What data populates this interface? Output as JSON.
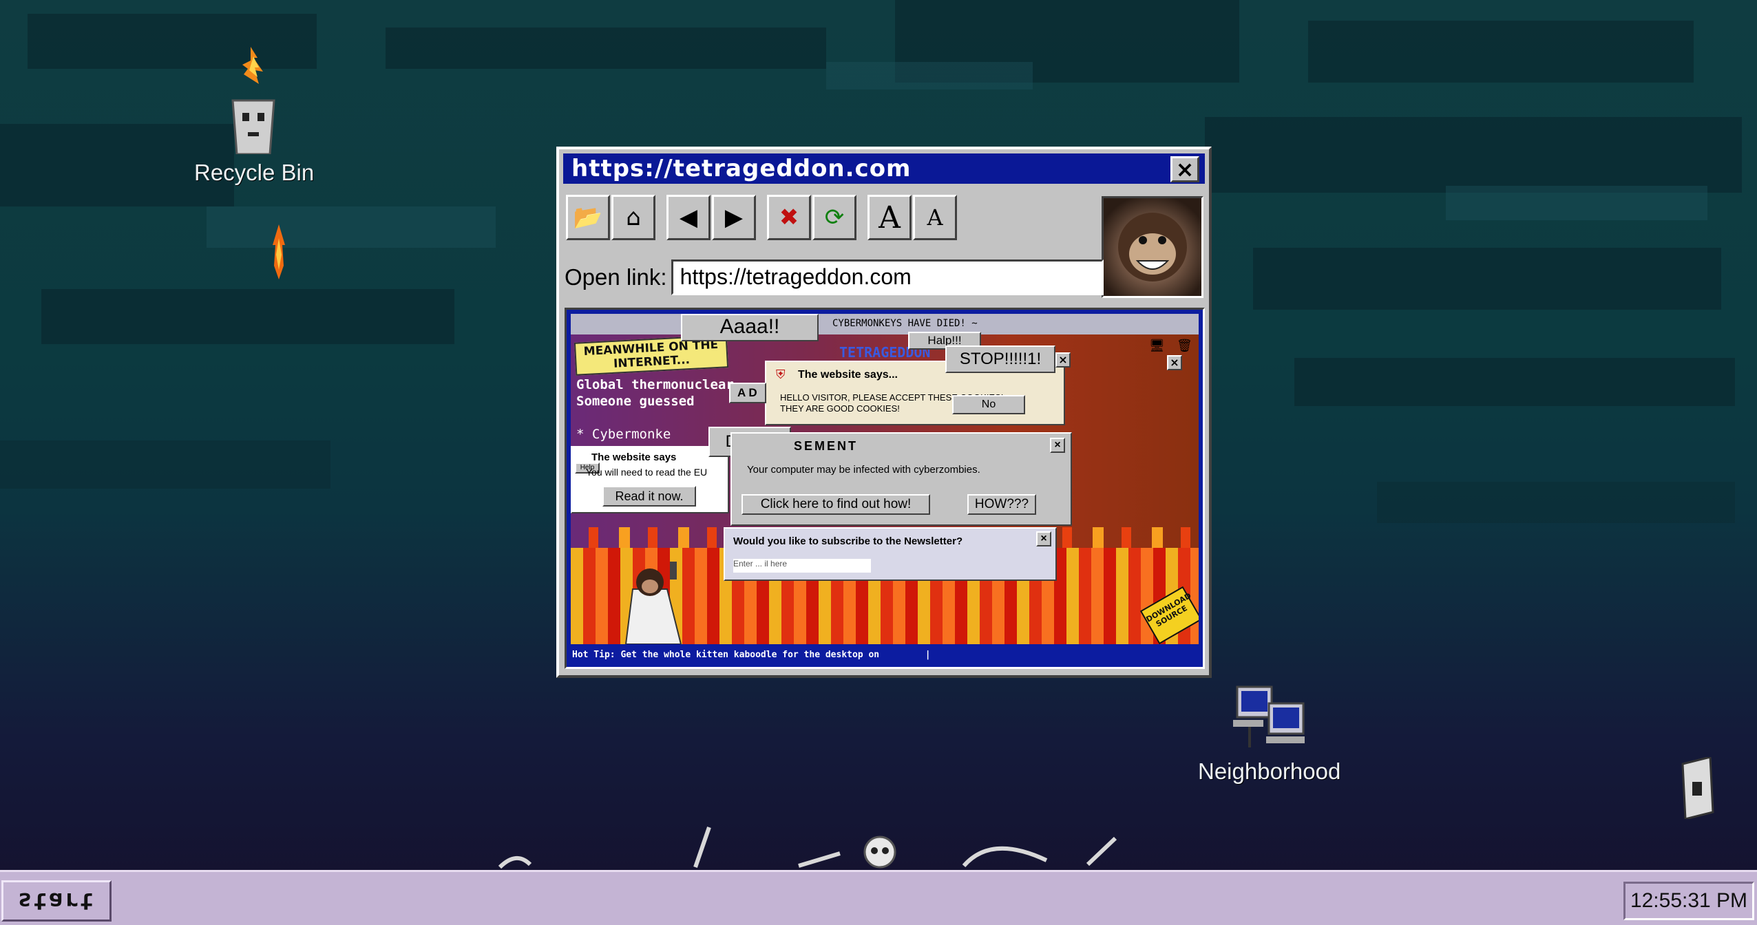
{
  "desktop": {
    "icons": [
      {
        "label": "Recycle Bin"
      },
      {
        "label": "Neighborhood"
      }
    ]
  },
  "browser": {
    "title": "https://tetrageddon.com",
    "close": "×",
    "open_link_label": "Open link:",
    "url_value": "https://tetrageddon.com",
    "toolbar": {
      "open": "📂",
      "home": "⌂",
      "back": "◀",
      "forward": "▶",
      "stop": "✖",
      "refresh": "⟳",
      "font_up": "A",
      "font_down": "A"
    },
    "page": {
      "banner_ticker": "CYBERMONKEYS HAVE DIED! ~",
      "meanwhile": "MEANWHILE ON THE INTERNET...",
      "tetrageddon_header": "TETRAGEDDON",
      "news_line1": "Global thermonuclear",
      "news_line2": "Someone guessed",
      "news_line3": "* Cybermonke",
      "hot_tip": "Hot Tip: Get the whole kitten kaboodle for the desktop on",
      "hot_tip_sep": "|",
      "popups": {
        "aaaa": "Aaaa!!",
        "help": "Halp!!!",
        "stop": "STOP!!!!!1!",
        "cookies_title": "The website says...",
        "cookies_body1": "HELLO VISITOR, PLEASE ACCEPT THESE COOKIES!",
        "cookies_body2": "THEY ARE GOOD COOKIES!",
        "cookies_no": "No",
        "ad_title_left": "A D",
        "debug": "Debug",
        "ad_title": "SEMENT",
        "ad_body": "Your computer may be infected with cyberzombies.",
        "ad_find": "Click here to find out how!",
        "ad_how": "HOW???",
        "eula_title": "The website says",
        "eula_help": "Help",
        "eula_body": "You will need to read the EU",
        "eula_read": "Read it now.",
        "newsletter_title": "Would you like to subscribe to the Newsletter?",
        "newsletter_input": "Enter ... il here",
        "download_badge": "DOWNLOAD SOURCE"
      }
    }
  },
  "taskbar": {
    "start": "start",
    "clock": "12:55:31 PM"
  },
  "colors": {
    "titlebar": "#0a1896",
    "taskbar": "#c4b4d4",
    "window": "#c3c3c3"
  }
}
